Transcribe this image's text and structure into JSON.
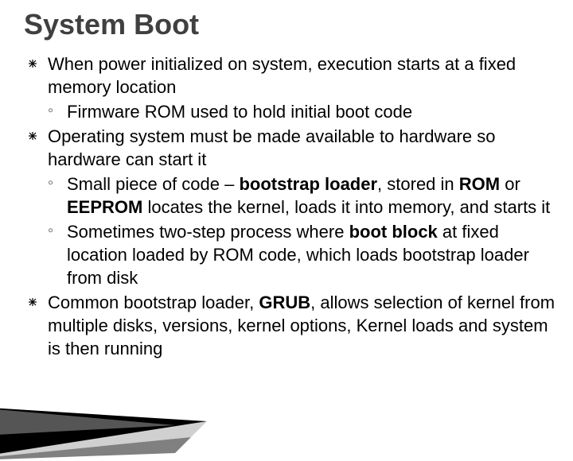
{
  "title": "System Boot",
  "bullets": {
    "b1": "When power initialized on system, execution starts at a fixed memory location",
    "b1s1": "Firmware ROM used to hold initial boot code",
    "b2": "Operating system must be made available to hardware so hardware can start it",
    "b2s1_a": "Small piece of code – ",
    "b2s1_b": "bootstrap loader",
    "b2s1_c": ", stored in ",
    "b2s1_d": "ROM",
    "b2s1_e": " or ",
    "b2s1_f": "EEPROM",
    "b2s1_g": " locates the kernel, loads it into memory, and starts it",
    "b2s2_a": "Sometimes two-step process where ",
    "b2s2_b": "boot block",
    "b2s2_c": " at fixed location loaded by ROM code, which loads bootstrap loader from disk",
    "b3_a": "Common bootstrap loader, ",
    "b3_b": "GRUB",
    "b3_c": ", allows selection of kernel from multiple disks, versions, kernel options, Kernel loads and system is then running"
  }
}
